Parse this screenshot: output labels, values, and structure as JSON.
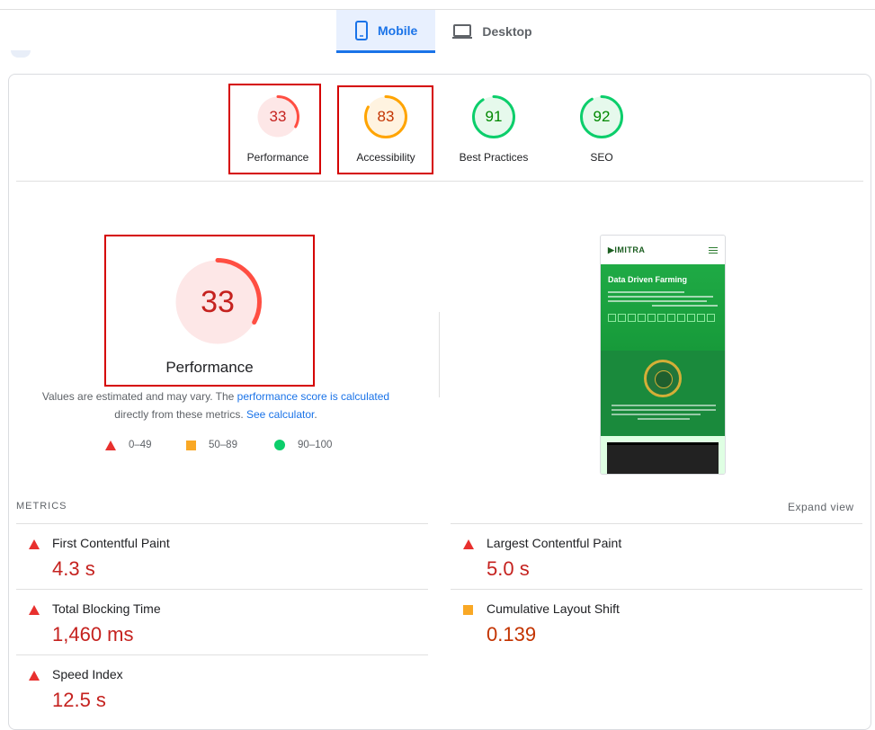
{
  "tabs": [
    {
      "label": "Mobile",
      "icon": "smartphone-icon",
      "active": true
    },
    {
      "label": "Desktop",
      "icon": "laptop-icon",
      "active": false
    }
  ],
  "gauges": [
    {
      "score": "33",
      "label": "Performance",
      "level": 0.33,
      "color": "#ff4e42",
      "text_color": "#c5221f",
      "bg": "#fde7e7"
    },
    {
      "score": "83",
      "label": "Accessibility",
      "level": 0.83,
      "color": "#ffa400",
      "text_color": "#c33300",
      "bg": "#fff3e0"
    },
    {
      "score": "91",
      "label": "Best Practices",
      "level": 0.91,
      "color": "#0cce6b",
      "text_color": "#008800",
      "bg": "#e6f9ec"
    },
    {
      "score": "92",
      "label": "SEO",
      "level": 0.92,
      "color": "#0cce6b",
      "text_color": "#008800",
      "bg": "#e6f9ec"
    }
  ],
  "performance": {
    "score": "33",
    "label": "Performance",
    "level": 0.33,
    "note_1": "Values are estimated and may vary. The ",
    "note_link_1": "performance score is calculated",
    "note_2": "directly from these metrics. ",
    "note_link_2": "See calculator",
    "note_3": "."
  },
  "legend": [
    {
      "range": "0–49",
      "shape": "triangle",
      "color": "#e8302e"
    },
    {
      "range": "50–89",
      "shape": "square",
      "color": "#f9a825"
    },
    {
      "range": "90–100",
      "shape": "circle",
      "color": "#0cce6b"
    }
  ],
  "screenshot": {
    "logo": "IMITRA",
    "hero_title": "Data Driven Farming"
  },
  "metrics": {
    "heading": "METRICS",
    "expand_label": "Expand view",
    "items": [
      {
        "name": "First Contentful Paint",
        "value": "4.3 s",
        "status": "fail"
      },
      {
        "name": "Largest Contentful Paint",
        "value": "5.0 s",
        "status": "fail"
      },
      {
        "name": "Total Blocking Time",
        "value": "1,460 ms",
        "status": "fail"
      },
      {
        "name": "Cumulative Layout Shift",
        "value": "0.139",
        "status": "average"
      },
      {
        "name": "Speed Index",
        "value": "12.5 s",
        "status": "fail"
      }
    ]
  }
}
